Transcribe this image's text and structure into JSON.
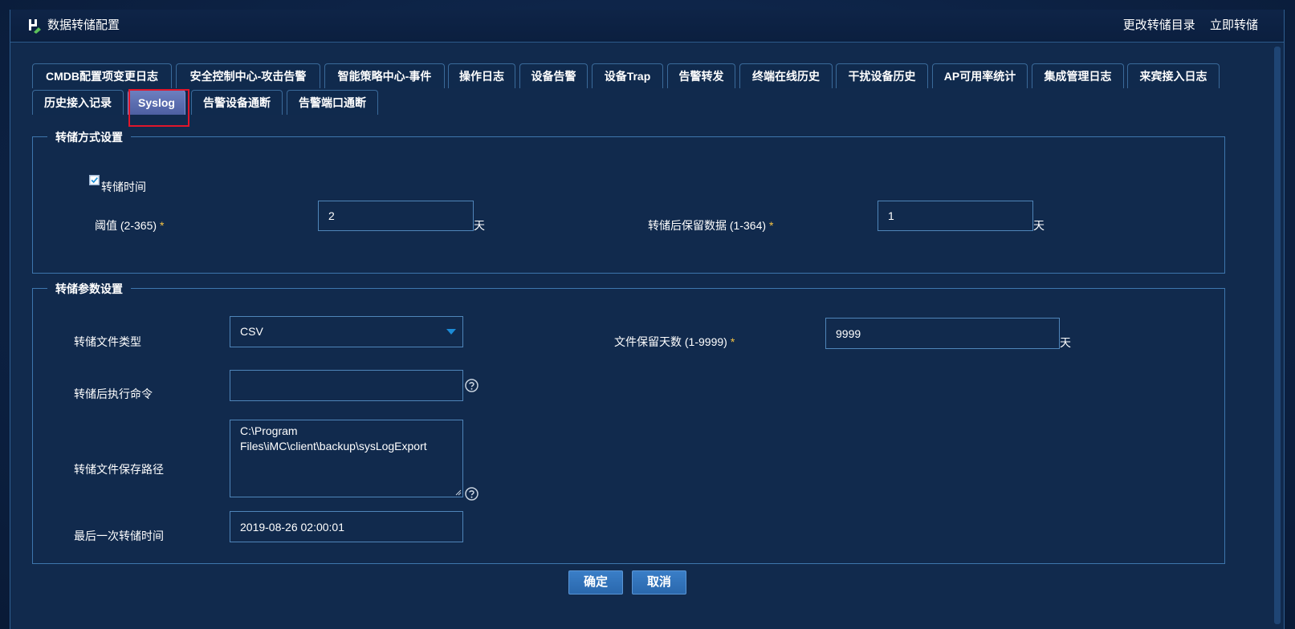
{
  "window": {
    "title": "数据转储配置",
    "actions": [
      "更改转储目录",
      "立即转储"
    ]
  },
  "tabs": [
    {
      "label": "CMDB配置项变更日志",
      "active": false
    },
    {
      "label": "安全控制中心-攻击告警",
      "active": false
    },
    {
      "label": "智能策略中心-事件",
      "active": false
    },
    {
      "label": "操作日志",
      "active": false
    },
    {
      "label": "设备告警",
      "active": false
    },
    {
      "label": "设备Trap",
      "active": false
    },
    {
      "label": "告警转发",
      "active": false
    },
    {
      "label": "终端在线历史",
      "active": false
    },
    {
      "label": "干扰设备历史",
      "active": false
    },
    {
      "label": "AP可用率统计",
      "active": false
    },
    {
      "label": "集成管理日志",
      "active": false
    },
    {
      "label": "来宾接入日志",
      "active": false
    },
    {
      "label": "历史接入记录",
      "active": false
    },
    {
      "label": "Syslog",
      "active": true
    },
    {
      "label": "告警设备通断",
      "active": false
    },
    {
      "label": "告警端口通断",
      "active": false
    }
  ],
  "dump_mode": {
    "legend": "转储方式设置",
    "dump_time_label": "转储时间",
    "dump_time_checked": true,
    "threshold_label": "阈值 (2-365)",
    "threshold_value": "2",
    "threshold_unit": "天",
    "retain_label": "转储后保留数据 (1-364)",
    "retain_value": "1",
    "retain_unit": "天",
    "required_mark": "*"
  },
  "dump_params": {
    "legend": "转储参数设置",
    "file_type_label": "转储文件类型",
    "file_type_value": "CSV",
    "file_retain_label": "文件保留天数 (1-9999)",
    "file_retain_value": "9999",
    "file_retain_unit": "天",
    "post_cmd_label": "转储后执行命令",
    "post_cmd_value": "",
    "save_path_label": "转储文件保存路径",
    "save_path_value": "C:\\Program Files\\iMC\\client\\backup\\sysLogExport",
    "last_time_label": "最后一次转储时间",
    "last_time_value": "2019-08-26 02:00:01",
    "required_mark": "*"
  },
  "buttons": {
    "ok": "确定",
    "cancel": "取消"
  },
  "colors": {
    "accent": "#2a68ad",
    "required": "#f6c343",
    "highlight": "#e0162b",
    "active_tab": "#5d6fb2"
  }
}
